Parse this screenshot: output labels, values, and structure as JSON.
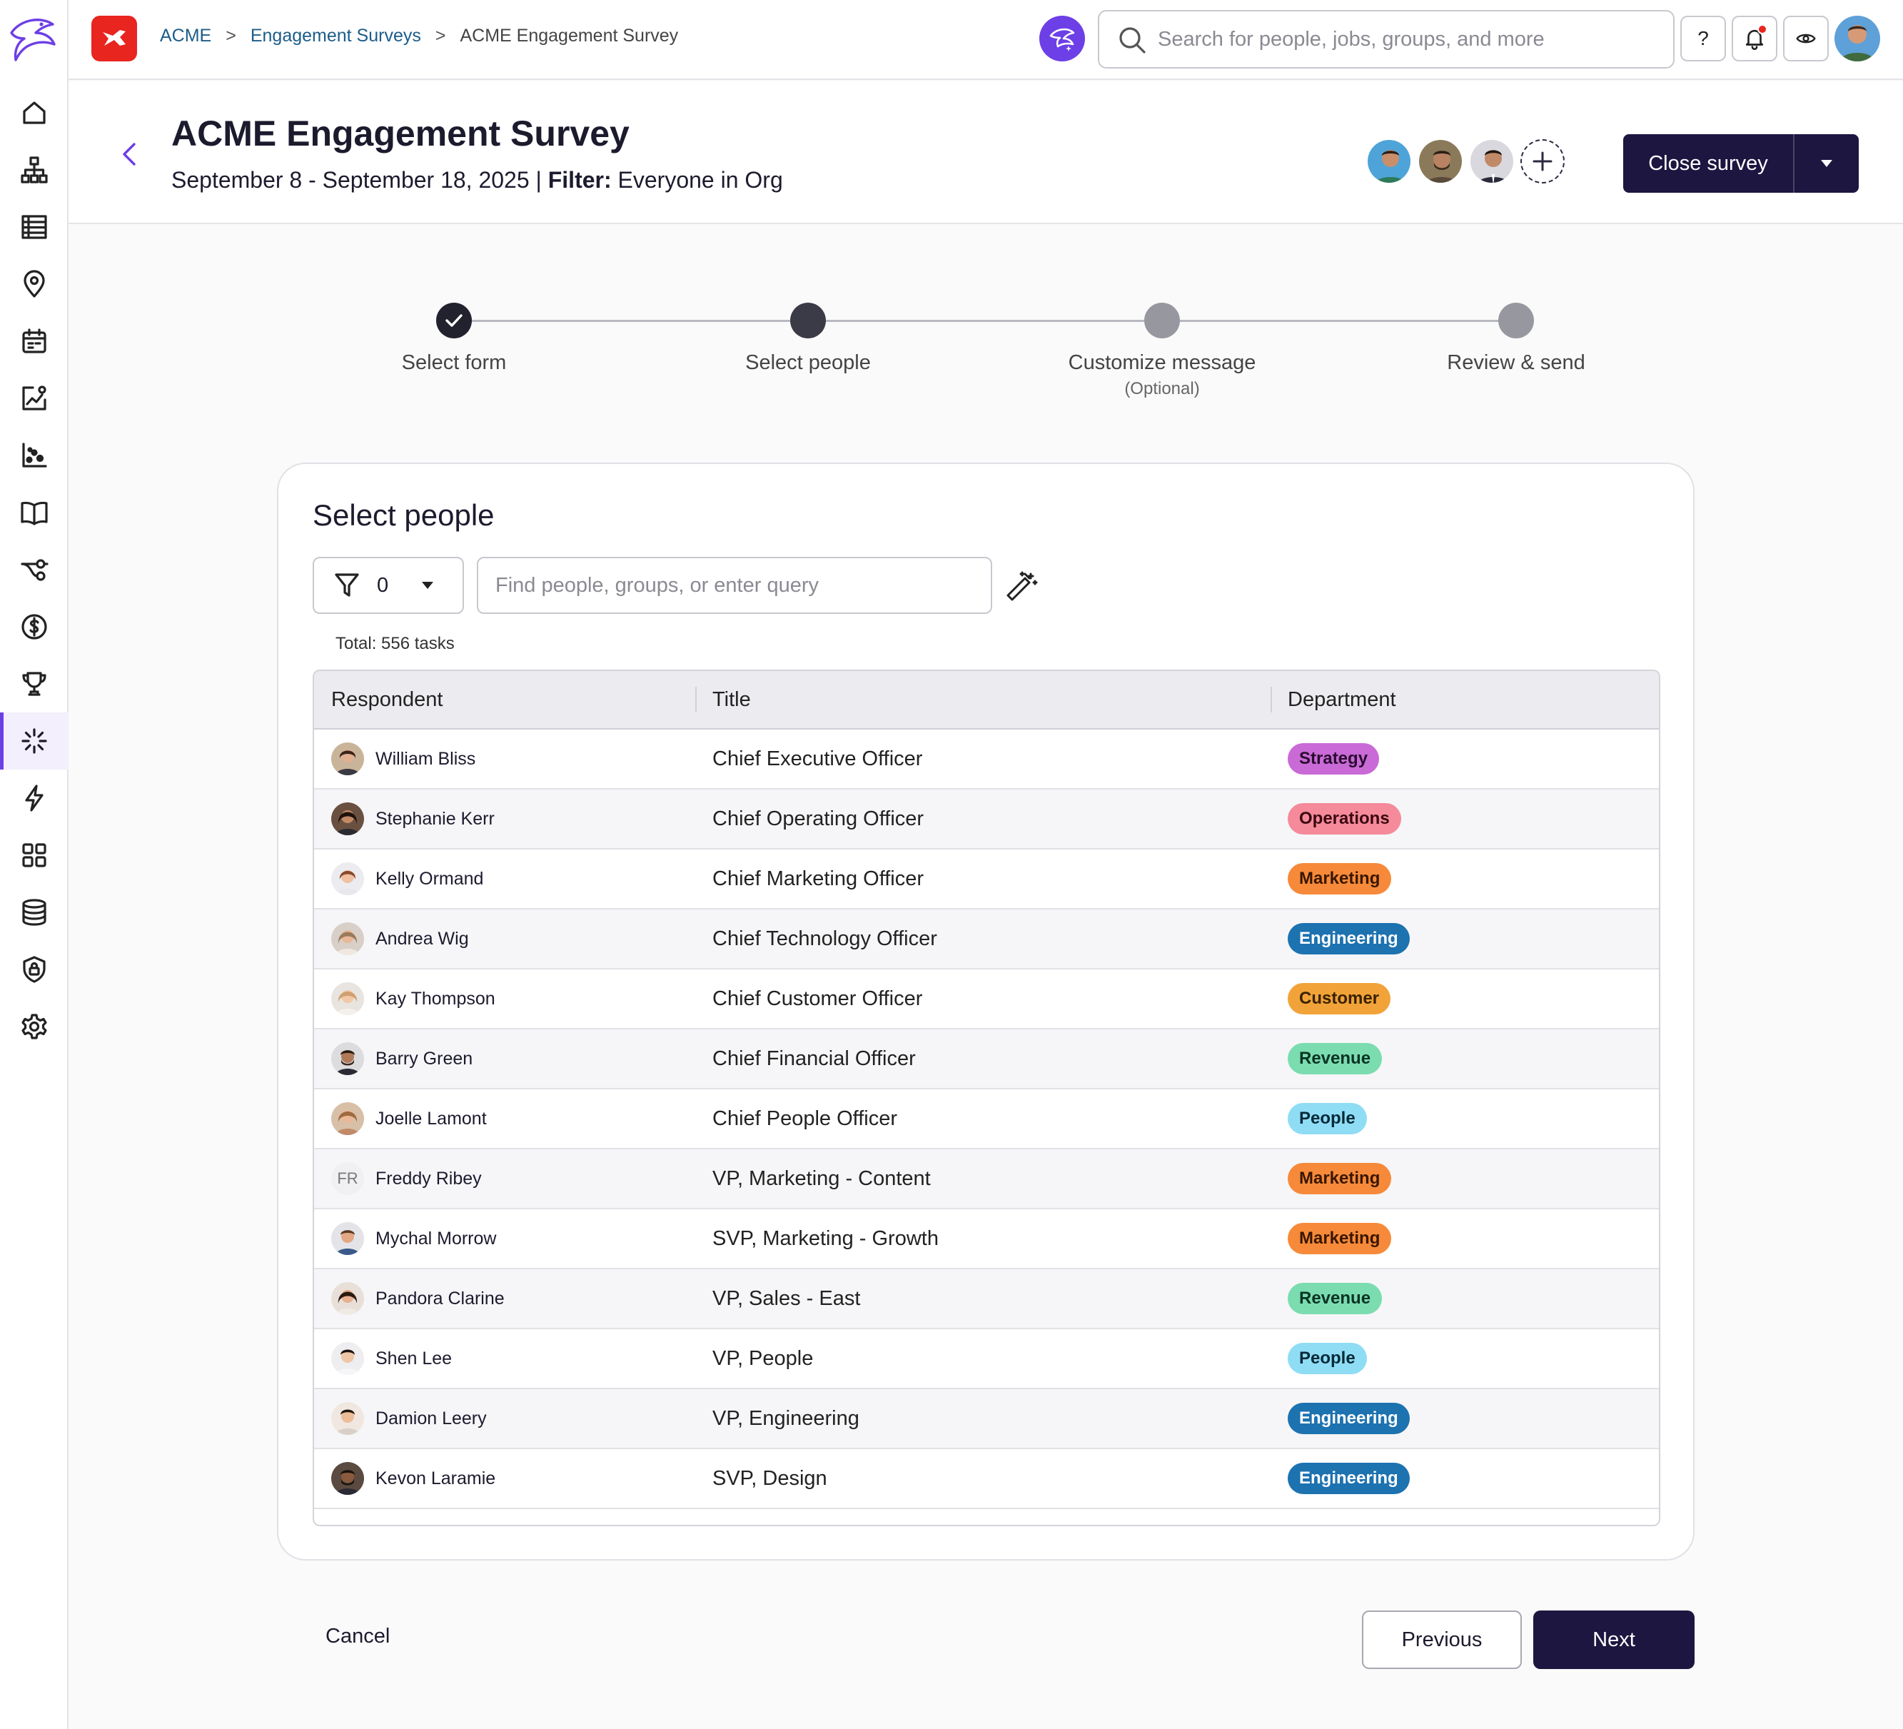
{
  "topbar": {
    "breadcrumbs": [
      "ACME",
      "Engagement Surveys",
      "ACME Engagement Survey"
    ],
    "separator": ">",
    "search_placeholder": "Search for people, jobs, groups, and more",
    "help_label": "?"
  },
  "header": {
    "title": "ACME Engagement Survey",
    "date_range": "September 8 - September 18, 2025",
    "divider": "|",
    "filter_label": "Filter:",
    "filter_value": "Everyone in Org",
    "close_label": "Close survey"
  },
  "stepper": {
    "steps": [
      {
        "label": "Select form",
        "state": "done"
      },
      {
        "label": "Select people",
        "state": "current"
      },
      {
        "label": "Customize message",
        "sub": "(Optional)",
        "state": "pending"
      },
      {
        "label": "Review & send",
        "state": "pending"
      }
    ]
  },
  "card": {
    "title": "Select people",
    "filter_count": "0",
    "search_placeholder": "Find people, groups, or enter query",
    "total": "Total: 556 tasks",
    "columns": [
      "Respondent",
      "Title",
      "Department"
    ],
    "rows": [
      {
        "name": "William Bliss",
        "title": "Chief Executive Officer",
        "dept": "Strategy"
      },
      {
        "name": "Stephanie Kerr",
        "title": "Chief Operating Officer",
        "dept": "Operations"
      },
      {
        "name": "Kelly Ormand",
        "title": "Chief Marketing Officer",
        "dept": "Marketing"
      },
      {
        "name": "Andrea Wig",
        "title": "Chief Technology Officer",
        "dept": "Engineering"
      },
      {
        "name": "Kay Thompson",
        "title": "Chief Customer Officer",
        "dept": "Customer"
      },
      {
        "name": "Barry Green",
        "title": "Chief Financial Officer",
        "dept": "Revenue"
      },
      {
        "name": "Joelle Lamont",
        "title": "Chief People Officer",
        "dept": "People"
      },
      {
        "name": "Freddy Ribey",
        "initials": "FR",
        "title": "VP, Marketing - Content",
        "dept": "Marketing"
      },
      {
        "name": "Mychal Morrow",
        "title": "SVP, Marketing - Growth",
        "dept": "Marketing"
      },
      {
        "name": "Pandora Clarine",
        "title": "VP, Sales - East",
        "dept": "Revenue"
      },
      {
        "name": "Shen Lee",
        "title": "VP, People",
        "dept": "People"
      },
      {
        "name": "Damion Leery",
        "title": "VP, Engineering",
        "dept": "Engineering"
      },
      {
        "name": "Kevon Laramie",
        "title": "SVP, Design",
        "dept": "Engineering"
      }
    ]
  },
  "footer": {
    "cancel": "Cancel",
    "previous": "Previous",
    "next": "Next"
  },
  "colors": {
    "accent": "#6d3fe6",
    "primary_dark": "#1c1640",
    "brand_red": "#e8251f"
  }
}
